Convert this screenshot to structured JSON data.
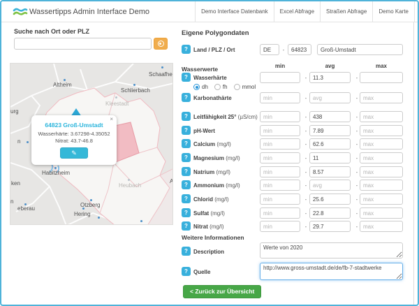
{
  "header": {
    "title": "Wassertipps Admin Interface Demo",
    "nav": [
      "Demo Interface Datenbank",
      "Excel Abfrage",
      "Straßen Abfrage",
      "Demo Karte"
    ]
  },
  "search": {
    "label": "Suche nach Ort oder PLZ",
    "value": "",
    "placeholder": ""
  },
  "map": {
    "popup": {
      "title": "64823 Groß-Umstadt",
      "hardness_line": "Wasserhärte: 3.67298-4.35052",
      "nitrate_line": "Nitrat: 43.7-46.8",
      "close_glyph": "×",
      "edit_glyph": "✎"
    },
    "labels": {
      "altheim": "Altheim",
      "schaafheim": "Schaafheim",
      "schlierbach": "Schlierbach",
      "kleestadt": "Kleestadt",
      "habitzheim": "Habitzheim",
      "heubach": "Heubach",
      "otzberg": "Otzberg",
      "hering": "Hering",
      "frag_urg": "urg",
      "frag_n1": "n",
      "frag_ken": "ken",
      "frag_n2": "n",
      "frag_eberau": "eberau",
      "frag_a": "A"
    }
  },
  "form": {
    "title": "Eigene Polygondaten",
    "dash": "-",
    "help_glyph": "?",
    "land_row": {
      "label": "Land / PLZ / Ort",
      "country": "DE",
      "plz": "64823",
      "city": "Groß-Umstadt"
    },
    "water_section": "Wasserwerte",
    "columns": {
      "min": "min",
      "avg": "avg",
      "max": "max"
    },
    "hardness_units": {
      "dh": "dh",
      "fh": "fh",
      "mmol": "mmol"
    },
    "rows": [
      {
        "label": "Wasserhärte",
        "unit": "",
        "min_value": "",
        "min_placeholder": "",
        "avg_value": "11.3",
        "avg_placeholder": "",
        "max_value": "",
        "max_placeholder": ""
      },
      {
        "label": "Karbonathärte",
        "unit": "",
        "min_value": "",
        "min_placeholder": "min",
        "avg_value": "",
        "avg_placeholder": "avg",
        "max_value": "",
        "max_placeholder": "max"
      },
      {
        "label": "Leitfähigkeit 25°",
        "unit": "(µS/cm)",
        "min_value": "",
        "min_placeholder": "min",
        "avg_value": "438",
        "avg_placeholder": "avg",
        "max_value": "",
        "max_placeholder": "max"
      },
      {
        "label": "pH-Wert",
        "unit": "",
        "min_value": "",
        "min_placeholder": "min",
        "avg_value": "7.89",
        "avg_placeholder": "avg",
        "max_value": "",
        "max_placeholder": "max"
      },
      {
        "label": "Calcium",
        "unit": "(mg/l)",
        "min_value": "",
        "min_placeholder": "min",
        "avg_value": "62.6",
        "avg_placeholder": "avg",
        "max_value": "",
        "max_placeholder": "max"
      },
      {
        "label": "Magnesium",
        "unit": "(mg/l)",
        "min_value": "",
        "min_placeholder": "min",
        "avg_value": "11",
        "avg_placeholder": "avg",
        "max_value": "",
        "max_placeholder": "max"
      },
      {
        "label": "Natrium",
        "unit": "(mg/l)",
        "min_value": "",
        "min_placeholder": "min",
        "avg_value": "8.57",
        "avg_placeholder": "avg",
        "max_value": "",
        "max_placeholder": "max"
      },
      {
        "label": "Ammonium",
        "unit": "(mg/l)",
        "min_value": "",
        "min_placeholder": "min",
        "avg_value": "",
        "avg_placeholder": "avg",
        "max_value": "",
        "max_placeholder": "max"
      },
      {
        "label": "Chlorid",
        "unit": "(mg/l)",
        "min_value": "",
        "min_placeholder": "min",
        "avg_value": "25.6",
        "avg_placeholder": "avg",
        "max_value": "",
        "max_placeholder": "max"
      },
      {
        "label": "Sulfat",
        "unit": "(mg/l)",
        "min_value": "",
        "min_placeholder": "min",
        "avg_value": "22.8",
        "avg_placeholder": "avg",
        "max_value": "",
        "max_placeholder": "max"
      },
      {
        "label": "Nitrat",
        "unit": "(mg/l)",
        "min_value": "",
        "min_placeholder": "min",
        "avg_value": "29.7",
        "avg_placeholder": "avg",
        "max_value": "",
        "max_placeholder": "max"
      }
    ],
    "more_section": "Weitere Informationen",
    "description_label": "Description",
    "description_value": "Werte von 2020",
    "quelle_label": "Quelle",
    "quelle_value": "http://www.gross-umstadt.de/de/fb-7-stadtwerke",
    "back_chevron": "<",
    "back_label": "Zurück zur Übersicht"
  },
  "colors": {
    "frame_blue": "#4fb3d9",
    "accent_cyan": "#35b8d8",
    "help_blue": "#38b0dc",
    "warning_orange": "#f0ad4e",
    "success_green": "#47a747",
    "focus_blue": "#66afe9",
    "map_highlight_pink": "#f2bcc3"
  }
}
